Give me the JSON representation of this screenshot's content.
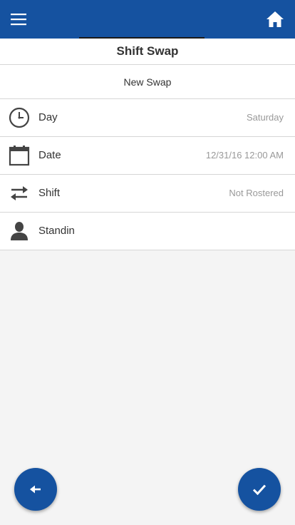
{
  "header": {
    "menu_icon": "hamburger-menu-icon",
    "home_icon": "home-icon",
    "background_color": "#1552a0"
  },
  "page": {
    "title": "Shift Swap",
    "subtitle": "New Swap"
  },
  "rows": [
    {
      "icon": "clock-icon",
      "label": "Day",
      "value": "Saturday"
    },
    {
      "icon": "calendar-icon",
      "label": "Date",
      "value": "12/31/16 12:00 AM"
    },
    {
      "icon": "swap-arrows-icon",
      "label": "Shift",
      "value": "Not Rostered"
    },
    {
      "icon": "person-icon",
      "label": "Standin",
      "value": ""
    }
  ],
  "actions": {
    "back_icon": "arrow-left-icon",
    "confirm_icon": "checkmark-icon"
  }
}
